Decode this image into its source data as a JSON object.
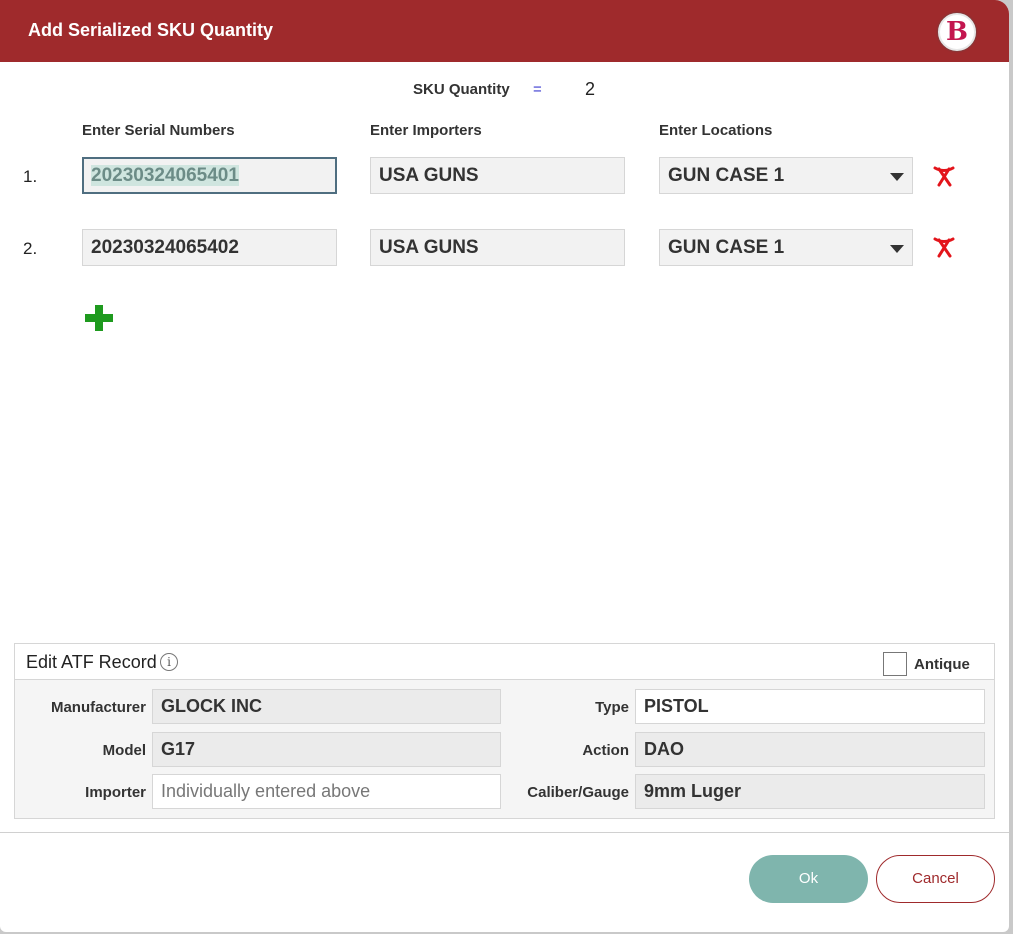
{
  "dialog": {
    "title": "Add Serialized SKU Quantity",
    "logo_letter": "B"
  },
  "sku_quantity": {
    "label": "SKU Quantity",
    "equals": "=",
    "value": "2"
  },
  "columns": {
    "serial": "Enter Serial Numbers",
    "importer": "Enter Importers",
    "location": "Enter Locations"
  },
  "rows": [
    {
      "num": "1.",
      "serial": "20230324065401",
      "importer": "USA GUNS",
      "location": "GUN CASE 1"
    },
    {
      "num": "2.",
      "serial": "20230324065402",
      "importer": "USA GUNS",
      "location": "GUN CASE 1"
    }
  ],
  "atf": {
    "title": "Edit ATF Record",
    "antique_label": "Antique",
    "antique_checked": false,
    "manufacturer_label": "Manufacturer",
    "manufacturer": "GLOCK INC",
    "model_label": "Model",
    "model": "G17",
    "importer_label": "Importer",
    "importer_placeholder": "Individually entered above",
    "type_label": "Type",
    "type": "PISTOL",
    "action_label": "Action",
    "action": "DAO",
    "caliber_label": "Caliber/Gauge",
    "caliber": "9mm Luger"
  },
  "buttons": {
    "ok": "Ok",
    "cancel": "Cancel"
  },
  "colors": {
    "header": "#9f2a2c",
    "ok_button": "#7fb5ad",
    "delete_icon": "#e3141b",
    "add_icon": "#1e9a1e"
  },
  "icons": {
    "logo": "brand-logo-icon",
    "delete": "delete-row-icon",
    "add": "add-row-icon",
    "info": "info-icon",
    "dropdown": "chevron-down-icon"
  }
}
